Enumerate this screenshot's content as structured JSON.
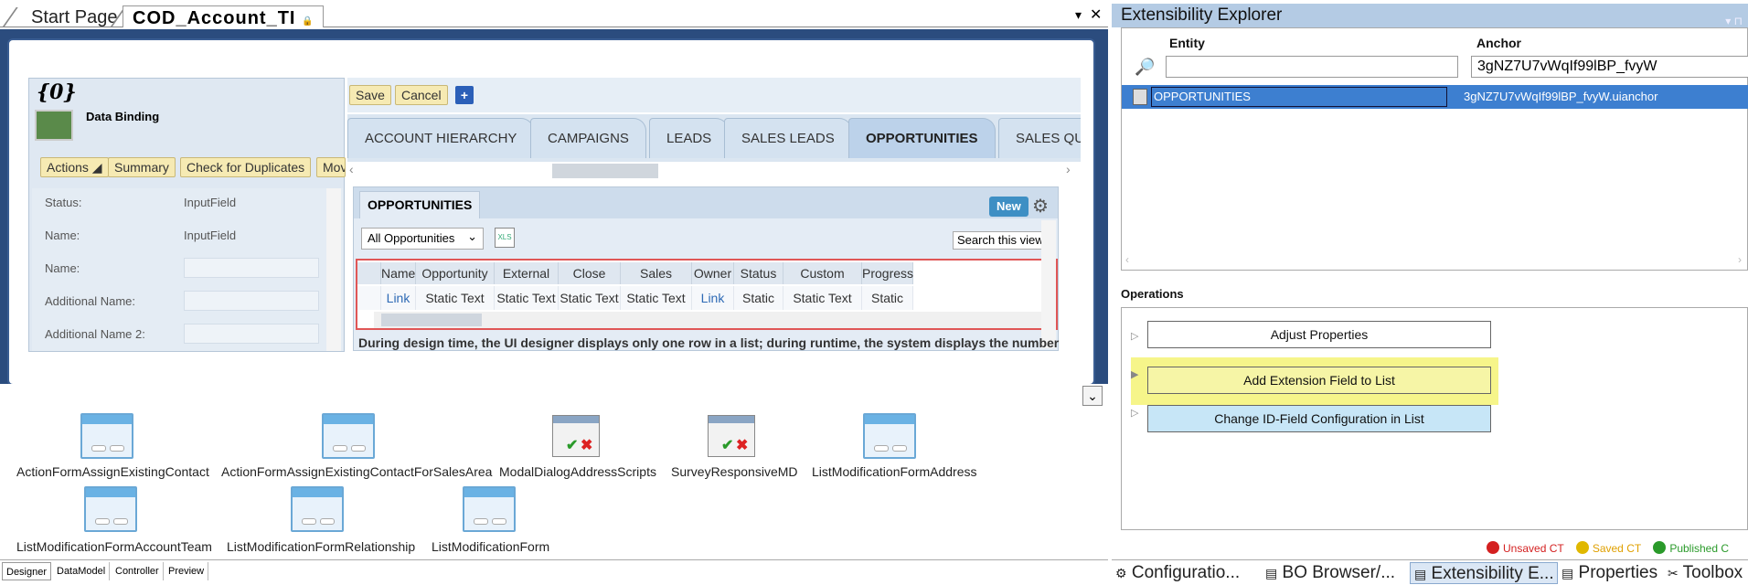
{
  "doc_tabs": {
    "start_page": "Start Page",
    "active_tab": "COD_Account_TI",
    "lock": "🔒",
    "dropdown": "▾",
    "close": "✕"
  },
  "form": {
    "title": "{0}",
    "data_binding": "Data Binding",
    "buttons": [
      "Actions ◢",
      "Summary",
      "Check for Duplicates",
      "Mov"
    ],
    "fields": [
      {
        "label": "Status:",
        "value": "InputField"
      },
      {
        "label": "Name:",
        "value": "InputField"
      },
      {
        "label": "Name:",
        "value": ""
      },
      {
        "label": "Additional Name:",
        "value": ""
      },
      {
        "label": "Additional Name 2:",
        "value": ""
      }
    ]
  },
  "toolbar": {
    "save": "Save",
    "cancel": "Cancel",
    "add": "+"
  },
  "tabs": [
    "ACCOUNT HIERARCHY",
    "CAMPAIGNS",
    "LEADS",
    "SALES LEADS",
    "OPPORTUNITIES",
    "SALES QUO"
  ],
  "active_tab": "OPPORTUNITIES",
  "scroll_left": "‹",
  "scroll_right": "›",
  "opportunities": {
    "title": "OPPORTUNITIES",
    "new_btn": "New",
    "gear": "⚙",
    "filter": "All Opportunities",
    "filter_caret": "⌄",
    "export_icon": "XLS",
    "search": "Search this view",
    "columns": [
      "Name",
      "Opportunity ID",
      "External ID",
      "Close Date",
      "Sales Phase",
      "Owner",
      "Status",
      "Custom Status",
      "Progress"
    ],
    "row": [
      "Link",
      "Static Text",
      "Static Text",
      "Static Text",
      "Static Text",
      "Link",
      "Static Text",
      "Static Text",
      "Static Tex"
    ],
    "note": "During design time, the UI designer displays only one row in a list; during runtime, the system displays the number"
  },
  "bottom_items": [
    "ActionFormAssignExistingContact",
    "ActionFormAssignExistingContactForSalesArea",
    "ModalDialogAddressScripts",
    "SurveyResponsiveMD",
    "ListModificationFormAddress",
    "ListModificationFormAccountTeam",
    "ListModificationFormRelationship",
    "ListModificationForm"
  ],
  "bottom_tabs": [
    "Designer",
    "DataModel",
    "Controller",
    "Preview"
  ],
  "collapse_glyph": "⌄",
  "explorer": {
    "title": "Extensibility Explorer",
    "pin": "▾ ⊓",
    "entity_header": "Entity",
    "anchor_header": "Anchor",
    "entity_value": "",
    "anchor_value": "3gNZ7U7vWqIf99lBP_fvyW",
    "search_icon": "🔎",
    "row_entity": "OPPORTUNITIES",
    "row_anchor": "3gNZ7U7vWqIf99lBP_fvyW.uianchor",
    "scroll_left": "‹",
    "scroll_right": "›",
    "operations_label": "Operations",
    "operations": [
      "Adjust Properties",
      "Add Extension Field to List",
      "Change ID-Field Configuration in List"
    ],
    "legend": [
      "Unsaved CT",
      "Saved CT",
      "Published C"
    ],
    "bottom_tabs": [
      "Configuratio...",
      "BO Browser/...",
      "Extensibility E...",
      "Properties",
      "Toolbox"
    ],
    "bottom_tab_icons": [
      "⚙",
      "▤",
      "▤",
      "▤",
      "✂"
    ]
  },
  "colors": {
    "accent_blue": "#3d7fd0",
    "canvas_navy": "#2b4c7e",
    "highlight_yellow": "#f6f58a",
    "op_yellow": "#f6f5a6",
    "op_blue": "#c7e6f7",
    "unsaved": "#d42020",
    "saved": "#e0b800",
    "published": "#2a9a2a"
  }
}
